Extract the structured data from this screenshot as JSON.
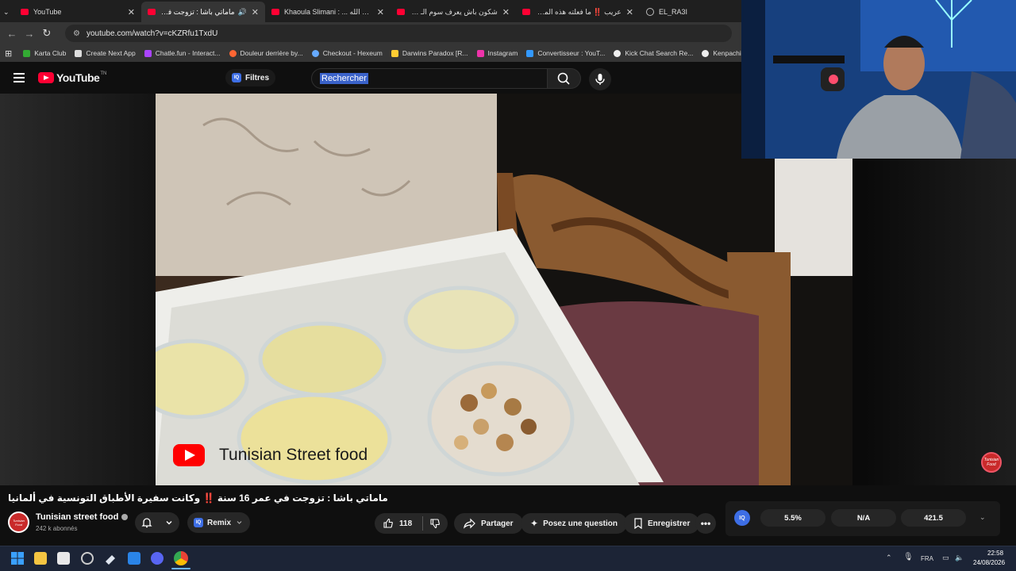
{
  "browser": {
    "tabs": [
      {
        "label": "YouTube",
        "active": false
      },
      {
        "label": "ماماتي باشا : تزوجت في عمر",
        "active": true
      },
      {
        "label": "Khaoula Slimani : ... من أجل الله",
        "active": false
      },
      {
        "label": "شكون باش يعرف سوم الـ PIZZA",
        "active": false
      },
      {
        "label": "عريب ‼️ ما فعلته هذه المرأة مع ...",
        "active": false
      },
      {
        "label": "EL_RA3I",
        "active": false
      }
    ],
    "url": "youtube.com/watch?v=cKZRfu1TxdU",
    "bookmarks": [
      {
        "label": "Karta Club",
        "color": "#3a3"
      },
      {
        "label": "Create Next App",
        "color": "#ddd"
      },
      {
        "label": "Chatle.fun - Interact...",
        "color": "#a4f"
      },
      {
        "label": "Douleur derrière by...",
        "color": "#f63"
      },
      {
        "label": "Checkout - Hexeum",
        "color": "#6af"
      },
      {
        "label": "Darwins Paradox [R...",
        "color": "#fc3"
      },
      {
        "label": "Instagram",
        "color": "#e3a"
      },
      {
        "label": "Convertisseur : YouT...",
        "color": "#39f"
      },
      {
        "label": "Kick Chat Search Re...",
        "color": "#eee"
      },
      {
        "label": "Kenpachi Zaraki Bl",
        "color": "#eee"
      }
    ]
  },
  "masthead": {
    "logo_text": "YouTube",
    "region": "TN",
    "filters_label": "Filtres",
    "search_value": "Rechercher"
  },
  "video": {
    "watermark_text": "Tunisian Street food",
    "badge_text": "Tunisian Food"
  },
  "details": {
    "title": "ماماتي باشا : تزوجت في عمر 16 سنة ‼️ وكانت سفيرة الأطباق التونسية في ألمانيا",
    "channel_name": "Tunisian street food",
    "subscribers": "242 k abonnés",
    "remix_label": "Remix",
    "likes": "118",
    "share_label": "Partager",
    "ask_label": "Posez une question",
    "save_label": "Enregistrer"
  },
  "stats": {
    "badge": "IQ",
    "values": [
      "5.5%",
      "N/A",
      "421.5"
    ]
  },
  "taskbar": {
    "lang": "FRA",
    "time": "22:58",
    "date": "24/08/2026"
  }
}
